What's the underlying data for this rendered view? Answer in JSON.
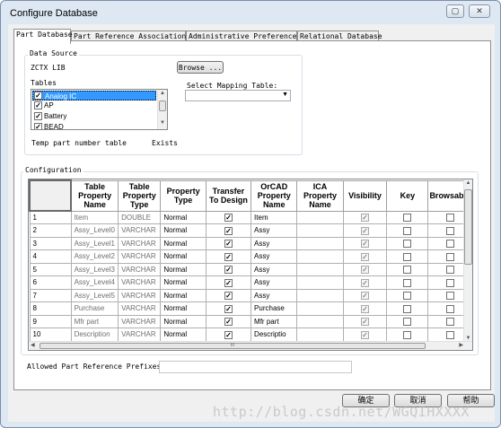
{
  "window": {
    "title": "Configure Database"
  },
  "tabs": [
    {
      "label": "Part Database"
    },
    {
      "label": "Part Reference Associations"
    },
    {
      "label": "Administrative Preferences"
    },
    {
      "label": "Relational Database"
    }
  ],
  "data_source": {
    "group_label": "Data Source",
    "source_name": "ZCTX LIB",
    "browse_label": "Browse ...",
    "tables_label": "Tables",
    "tables": [
      {
        "label": "Analog IC",
        "checked": true,
        "selected": true
      },
      {
        "label": "AP",
        "checked": true,
        "selected": false
      },
      {
        "label": "Battery",
        "checked": true,
        "selected": false
      },
      {
        "label": "BEAD",
        "checked": true,
        "selected": false
      }
    ],
    "mapping_label": "Select Mapping Table:",
    "mapping_value": "",
    "temp_label": "Temp part number table",
    "temp_status": "Exists"
  },
  "configuration": {
    "group_label": "Configuration",
    "columns": [
      "Table Property Name",
      "Table Property Type",
      "Property Type",
      "Transfer To Design",
      "OrCAD Property Name",
      "ICA Property Name",
      "Visibility",
      "Key",
      "Browsable"
    ],
    "rows": [
      {
        "n": "1",
        "name": "Item",
        "type": "DOUBLE",
        "ptype": "Normal",
        "transfer": true,
        "orcad": "Item",
        "ica": "",
        "vis": true,
        "key": false,
        "browse": false
      },
      {
        "n": "2",
        "name": "Assy_Level0",
        "type": "VARCHAR",
        "ptype": "Normal",
        "transfer": true,
        "orcad": "Assy",
        "ica": "",
        "vis": true,
        "key": false,
        "browse": false
      },
      {
        "n": "3",
        "name": "Assy_Level1",
        "type": "VARCHAR",
        "ptype": "Normal",
        "transfer": true,
        "orcad": "Assy",
        "ica": "",
        "vis": true,
        "key": false,
        "browse": false
      },
      {
        "n": "4",
        "name": "Assy_Level2",
        "type": "VARCHAR",
        "ptype": "Normal",
        "transfer": true,
        "orcad": "Assy",
        "ica": "",
        "vis": true,
        "key": false,
        "browse": false
      },
      {
        "n": "5",
        "name": "Assy_Level3",
        "type": "VARCHAR",
        "ptype": "Normal",
        "transfer": true,
        "orcad": "Assy",
        "ica": "",
        "vis": true,
        "key": false,
        "browse": false
      },
      {
        "n": "6",
        "name": "Assy_Level4",
        "type": "VARCHAR",
        "ptype": "Normal",
        "transfer": true,
        "orcad": "Assy",
        "ica": "",
        "vis": true,
        "key": false,
        "browse": false
      },
      {
        "n": "7",
        "name": "Assy_Level5",
        "type": "VARCHAR",
        "ptype": "Normal",
        "transfer": true,
        "orcad": "Assy",
        "ica": "",
        "vis": true,
        "key": false,
        "browse": false
      },
      {
        "n": "8",
        "name": "Purchase",
        "type": "VARCHAR",
        "ptype": "Normal",
        "transfer": true,
        "orcad": "Purchase",
        "ica": "",
        "vis": true,
        "key": false,
        "browse": false
      },
      {
        "n": "9",
        "name": "Mfr part",
        "type": "VARCHAR",
        "ptype": "Normal",
        "transfer": true,
        "orcad": "Mfr part",
        "ica": "",
        "vis": true,
        "key": false,
        "browse": false
      },
      {
        "n": "10",
        "name": "Description",
        "type": "VARCHAR",
        "ptype": "Normal",
        "transfer": true,
        "orcad": "Descriptio",
        "ica": "",
        "vis": true,
        "key": false,
        "browse": false
      }
    ],
    "scroll_grip": "III"
  },
  "prefix": {
    "label": "Allowed Part Reference Prefixes :",
    "value": ""
  },
  "buttons": {
    "ok": "确定",
    "cancel": "取消",
    "help": "帮助"
  },
  "watermark": "http://blog.csdn.net/WGQIHXXXX",
  "icons": [
    "restore-icon",
    "close-icon",
    "dropdown-arrow-icon",
    "scroll-up-icon",
    "scroll-down-icon",
    "scroll-left-icon",
    "scroll-right-icon",
    "check-icon"
  ]
}
